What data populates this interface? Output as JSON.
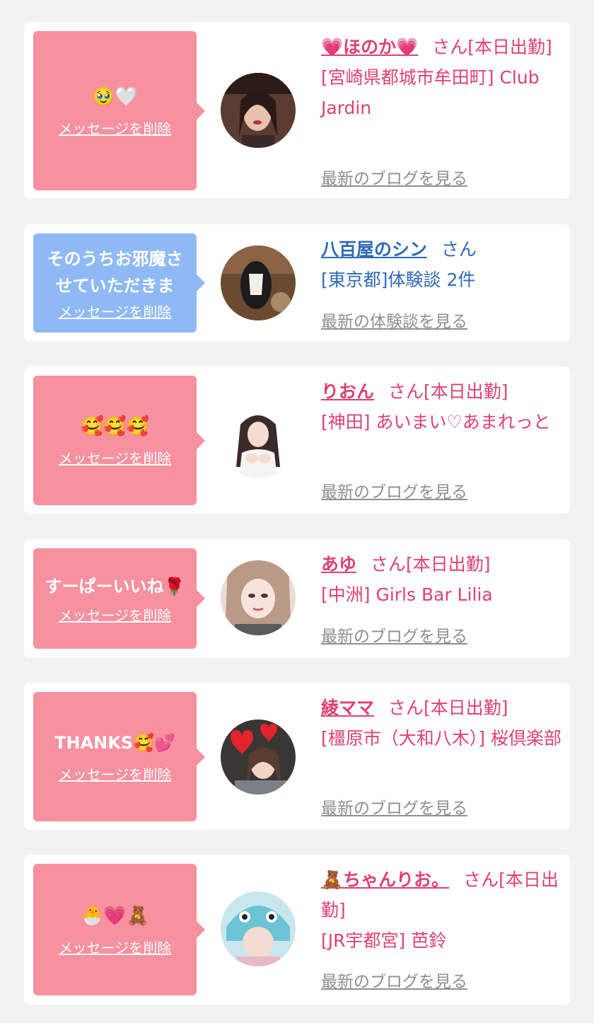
{
  "delete_label": "メッセージを削除",
  "san_label": "さん",
  "cards": [
    {
      "message": "🥹🤍",
      "name": "💗ほのか💗",
      "status": "[本日出勤]",
      "location": "[宮崎県都城市牟田町] Club Jardin",
      "link": "最新のブログを見る"
    },
    {
      "message": "そのうちお邪魔させていただきま",
      "name": "八百屋のシン",
      "status": "",
      "location": "[東京都]体験談 2件",
      "link": "最新の体験談を見る"
    },
    {
      "message": "🥰🥰🥰",
      "name": "りおん",
      "status": "[本日出勤]",
      "location": "[神田] あいまい♡あまれっと",
      "link": "最新のブログを見る"
    },
    {
      "message": "すーぱーいいね🌹",
      "name": "あゆ",
      "status": "[本日出勤]",
      "location": "[中洲] Girls Bar Lilia",
      "link": "最新のブログを見る"
    },
    {
      "message": "THANKS🥰💕",
      "name": "綾ママ",
      "status": "[本日出勤]",
      "location": "[橿原市（大和八木）] 桜倶楽部",
      "link": "最新のブログを見る"
    },
    {
      "message": "🐣💗🧸",
      "name": "🧸ちゃんりお。",
      "status": "[本日出勤]",
      "location": "[JR宇都宮] 芭鈴",
      "link": "最新のブログを見る"
    }
  ]
}
